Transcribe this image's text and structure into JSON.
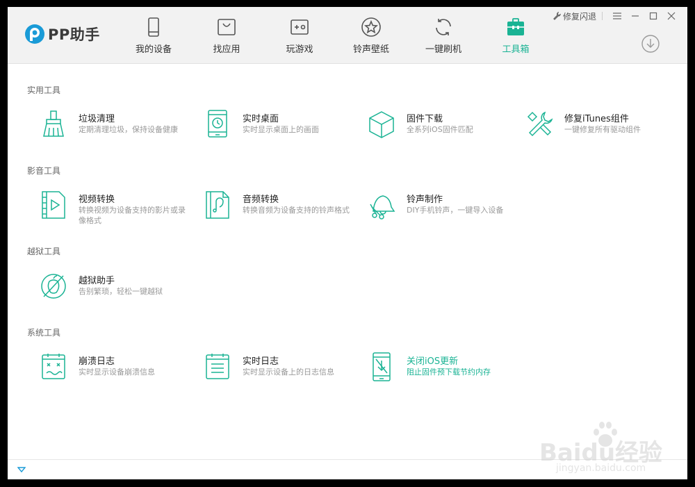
{
  "app": {
    "name": "PP助手",
    "accent": "#1ab394",
    "top_actions": {
      "repair_quit": "修复闪退"
    }
  },
  "nav": [
    {
      "label": "我的设备",
      "icon": "phone-icon"
    },
    {
      "label": "找应用",
      "icon": "app-bag-icon"
    },
    {
      "label": "玩游戏",
      "icon": "gamepad-icon"
    },
    {
      "label": "铃声壁纸",
      "icon": "star-icon"
    },
    {
      "label": "一键刷机",
      "icon": "refresh-icon"
    },
    {
      "label": "工具箱",
      "icon": "toolbox-icon",
      "active": true
    }
  ],
  "sections": [
    {
      "title": "实用工具",
      "tools": [
        {
          "name": "垃圾清理",
          "desc": "定期清理垃圾，保持设备健康",
          "icon": "broom-icon"
        },
        {
          "name": "实时桌面",
          "desc": "实时显示桌面上的画面",
          "icon": "tablet-clock-icon"
        },
        {
          "name": "固件下载",
          "desc": "全系列iOS固件匹配",
          "icon": "cube-icon"
        },
        {
          "name": "修复iTunes组件",
          "desc": "一键修复所有驱动组件",
          "icon": "wrench-icon"
        }
      ]
    },
    {
      "title": "影音工具",
      "tools": [
        {
          "name": "视频转换",
          "desc": "转换视频为设备支持的影片或录像格式",
          "icon": "video-file-icon"
        },
        {
          "name": "音频转换",
          "desc": "转换音频为设备支持的铃声格式",
          "icon": "audio-file-icon"
        },
        {
          "name": "铃声制作",
          "desc": "DIY手机铃声，一键导入设备",
          "icon": "bell-scissors-icon"
        }
      ]
    },
    {
      "title": "越狱工具",
      "tools": [
        {
          "name": "越狱助手",
          "desc": "告别繁琐，轻松一键越狱",
          "icon": "jailbreak-icon"
        }
      ]
    },
    {
      "title": "系统工具",
      "tools": [
        {
          "name": "崩溃日志",
          "desc": "实时显示设备崩溃信息",
          "icon": "crash-log-icon"
        },
        {
          "name": "实时日志",
          "desc": "实时显示设备上的日志信息",
          "icon": "live-log-icon"
        },
        {
          "name": "关闭iOS更新",
          "desc": "阻止固件预下载节约内存",
          "icon": "block-update-icon",
          "highlight": true
        }
      ]
    }
  ],
  "watermark": {
    "brand": "Baidu经验",
    "url": "jingyan.baidu.com"
  }
}
